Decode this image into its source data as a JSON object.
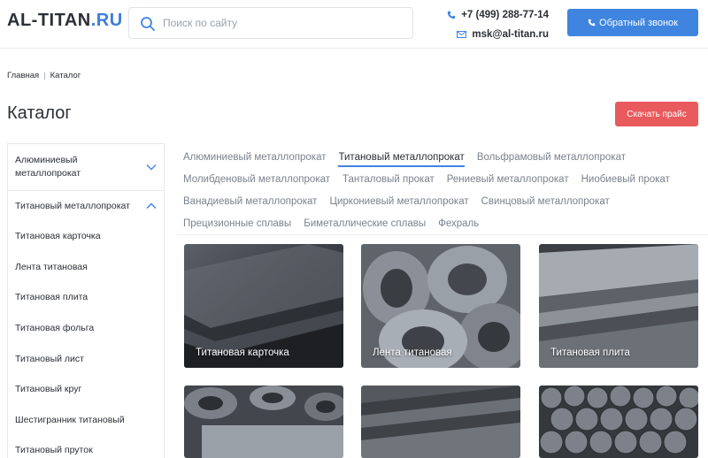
{
  "header": {
    "logo_main": "AL-TITAN",
    "logo_suffix": ".RU",
    "search_placeholder": "Поиск по сайту",
    "phone": "+7 (499) 288-77-14",
    "email": "msk@al-titan.ru",
    "callback_label": "Обратный звонок"
  },
  "breadcrumb": {
    "items": [
      "Главная",
      "Каталог"
    ]
  },
  "page": {
    "title": "Каталог",
    "price_button": "Скачать прайс"
  },
  "sidebar": {
    "groups": [
      {
        "label": "Алюминиевый металлопрокат",
        "expanded": false
      },
      {
        "label": "Титановый металлопрокат",
        "expanded": true
      }
    ],
    "items": [
      "Титановая карточка",
      "Лента титановая",
      "Титановая плита",
      "Титановая фольга",
      "Титановый лист",
      "Титановый круг",
      "Шестигранник титановый",
      "Титановый пруток"
    ]
  },
  "tabs": {
    "rows": [
      [
        "Алюминиевый металлопрокат",
        "Титановый металлопрокат",
        "Вольфрамовый металлопрокат"
      ],
      [
        "Молибденовый металлопрокат",
        "Танталовый прокат",
        "Рениевый металлопрокат",
        "Ниобиевый прокат"
      ],
      [
        "Ванадиевый металлопрокат",
        "Циркониевый металлопрокат",
        "Свинцовый металлопрокат"
      ],
      [
        "Прецизионные сплавы",
        "Биметаллические сплавы",
        "Фехраль"
      ]
    ],
    "active": "Титановый металлопрокат"
  },
  "products": [
    {
      "label": "Титановая карточка"
    },
    {
      "label": "Лента титановая"
    },
    {
      "label": "Титановая плита"
    },
    {
      "label": ""
    },
    {
      "label": ""
    },
    {
      "label": ""
    }
  ],
  "colors": {
    "accent_blue": "#3f85e0",
    "price_red": "#e85a5c",
    "text_dark": "#2b2f36",
    "text_muted": "#7b828c"
  },
  "icons": {
    "search": "search-icon",
    "phone": "phone-icon",
    "email": "mail-icon",
    "chevron_down": "chevron-down-icon",
    "chevron_up": "chevron-up-icon"
  }
}
